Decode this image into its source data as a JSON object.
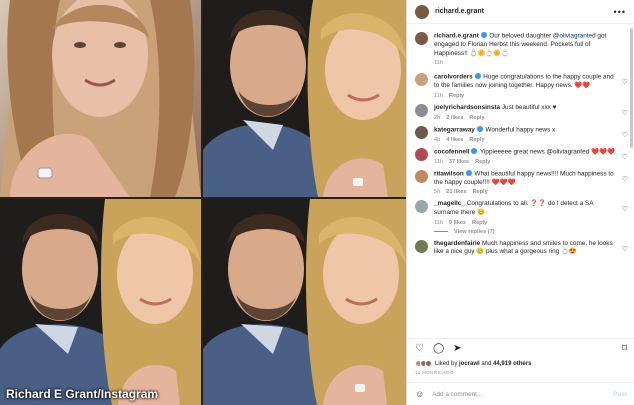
{
  "credit": "Richard E Grant/Instagram",
  "post": {
    "username": "richard.e.grant",
    "more_icon": "more-dots-icon",
    "caption": {
      "user": "richard.e.grant",
      "text_before": "Our beloved daughter ",
      "mention": "@oliviagranted",
      "text_after": " got engaged to Florian Herbst this weekend. Pockets full of Happiness!! 💍🌼💍🌼💍",
      "time": "11h"
    },
    "comments": [
      {
        "user": "carolvorders",
        "text": "Huge congratulations to the happy couple and to the families now joining together. Happy news. ❤️❤️",
        "time": "11h",
        "likes": "",
        "reply": "Reply",
        "avatar_color": "#c9a27e"
      },
      {
        "user": "joelyrichardsonsinsta",
        "text": "Just beautiful xxx ♥",
        "time": "2h",
        "likes": "2 likes",
        "reply": "Reply",
        "avatar_color": "#8a8f96"
      },
      {
        "user": "kategarraway",
        "text": "Wonderful happy news x",
        "time": "4h",
        "likes": "4 likes",
        "reply": "Reply",
        "avatar_color": "#6d5a4a"
      },
      {
        "user": "cocofennell",
        "text": "Yippieeeee great news @oliviagranted ❤️❤️❤️",
        "time": "11h",
        "likes": "37 likes",
        "reply": "Reply",
        "avatar_color": "#b04a54"
      },
      {
        "user": "ritawilson",
        "text": "What beautiful happy news!!!! Much happiness to the happy couple!!!! ❤️❤️❤️",
        "time": "5h",
        "likes": "21 likes",
        "reply": "Reply",
        "avatar_color": "#c08a5e"
      },
      {
        "user": "_magellc_",
        "text": "Congratulations to all. ❓❓ do I detect a SA surname there 😊",
        "time": "11h",
        "likes": "9 likes",
        "reply": "Reply",
        "avatar_color": "#9aa5ae",
        "view_replies": "View replies (7)"
      },
      {
        "user": "thegardenfairie",
        "text": "Much happiness and smiles to come, he looks like a nice guy 😊 plus what a gorgeous ring 💍😍",
        "time": "",
        "likes": "",
        "reply": "",
        "avatar_color": "#6b7d52"
      }
    ],
    "actions": {
      "like": "heart-icon",
      "comment": "comment-icon",
      "share": "share-icon",
      "save": "bookmark-icon"
    },
    "likes_text_prefix": "Liked by ",
    "likes_user": "jocrawl",
    "likes_mid": " and ",
    "likes_count": "44,919 others",
    "timestamp": "11 HOURS AGO",
    "add_comment_placeholder": "Add a comment...",
    "post_label": "Post"
  }
}
